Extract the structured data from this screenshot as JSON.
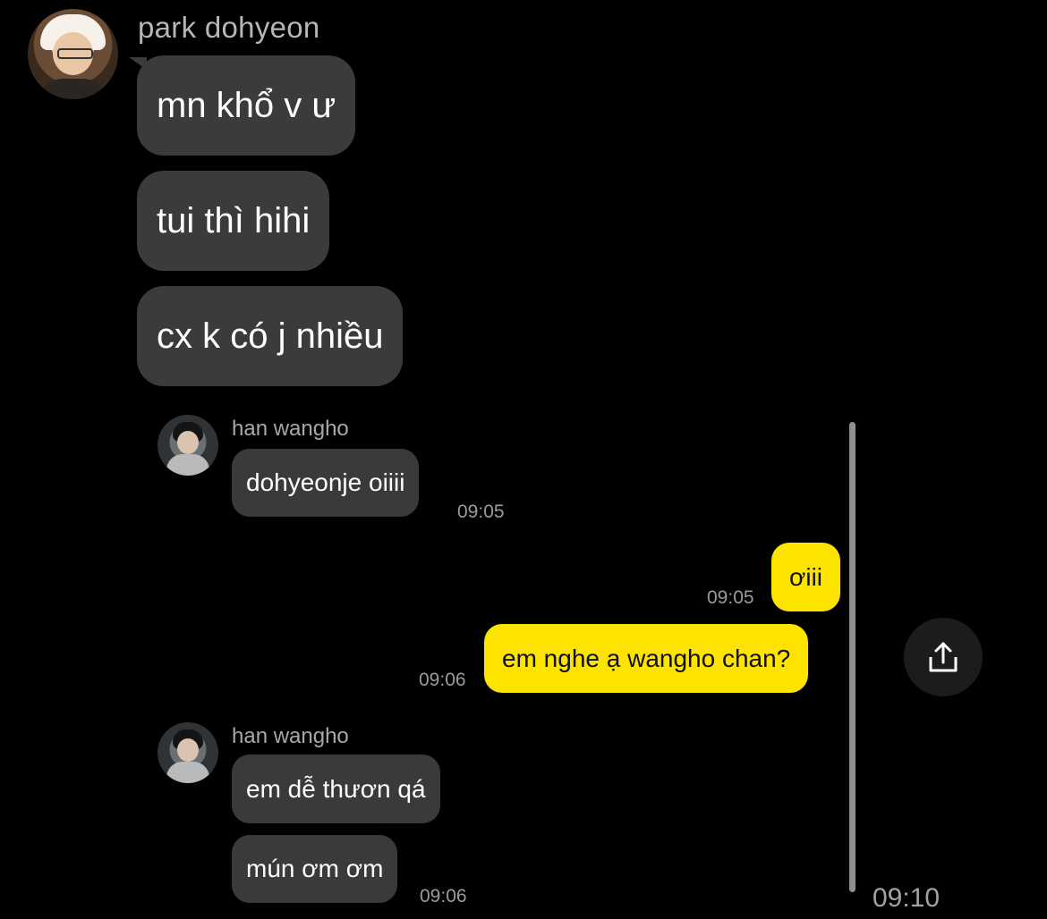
{
  "outer_chat": {
    "sender_name": "park dohyeon",
    "messages": [
      "mn khổ v ư",
      "tui thì hihi",
      "cx k có j nhiều"
    ],
    "time": "09:10"
  },
  "inner_screenshot": {
    "sender_name_1": "han wangho",
    "msg_1": "dohyeonje oiiii",
    "time_1": "09:05",
    "reply_1": "ơiii",
    "reply_time_1": "09:05",
    "reply_2": "em nghe ạ wangho chan?",
    "reply_time_2": "09:06",
    "sender_name_2": "han wangho",
    "msg_2": "em dễ thươn qá",
    "msg_3": "mún ơm ơm",
    "time_2": "09:06"
  },
  "share_button": {
    "icon": "share-icon"
  },
  "colors": {
    "background": "#000000",
    "incoming_bubble": "#3b3b3d",
    "outgoing_bubble": "#fce300"
  }
}
